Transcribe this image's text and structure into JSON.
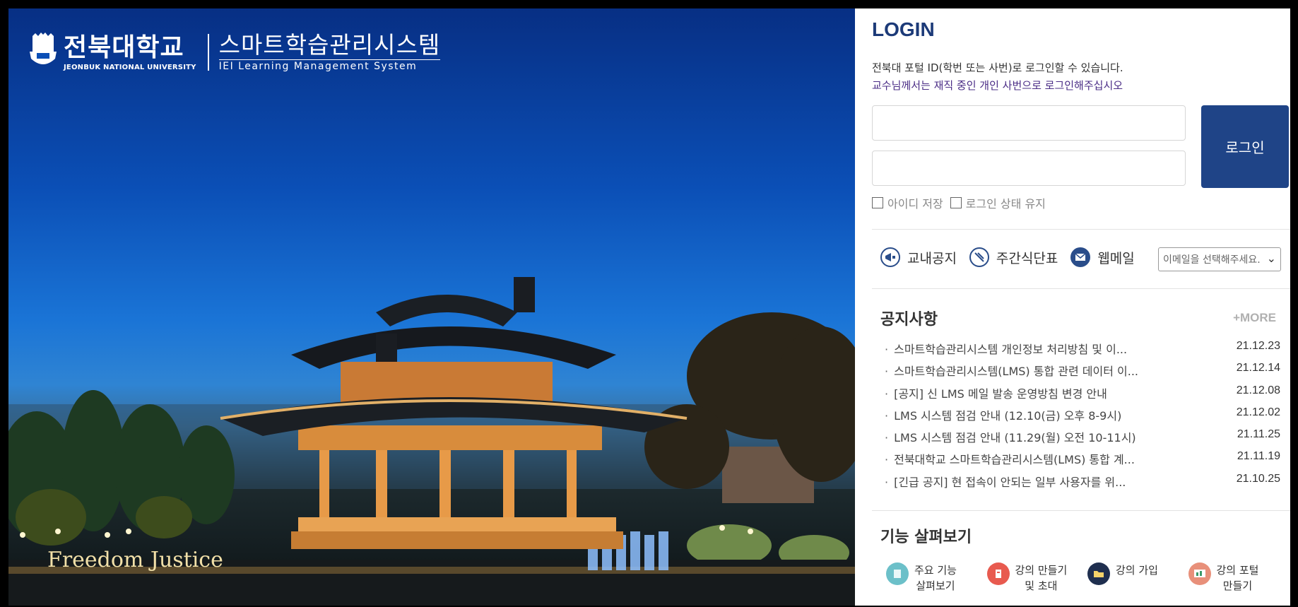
{
  "brand": {
    "university_ko": "전북대학교",
    "university_en": "JEONBUK NATIONAL UNIVERSITY",
    "system_ko": "스마트학습관리시스템",
    "system_en": "IEI Learning Management System",
    "sign_text": "Freedom Justice"
  },
  "login": {
    "title": "LOGIN",
    "notice_line1": "전북대 포털 ID(학번 또는 사번)로 로그인할 수 있습니다.",
    "notice_line2": "교수님께서는 재직 중인 개인 사번으로 로그인해주십시오",
    "id_value": "",
    "pw_value": "",
    "button_label": "로그인",
    "save_id_label": "아이디 저장",
    "keep_login_label": "로그인 상태 유지"
  },
  "quick_links": [
    {
      "label": "교내공지",
      "icon": "megaphone-icon"
    },
    {
      "label": "주간식단표",
      "icon": "utensils-icon"
    },
    {
      "label": "웹메일",
      "icon": "mail-icon"
    }
  ],
  "mail_select": {
    "selected": "이메일을 선택해주세요."
  },
  "notices": {
    "title": "공지사항",
    "more_label": "+MORE",
    "items": [
      {
        "title": "스마트학습관리시스템 개인정보 처리방침 및 이...",
        "date": "21.12.23"
      },
      {
        "title": "스마트학습관리시스템(LMS) 통합 관련 데이터 이...",
        "date": "21.12.14"
      },
      {
        "title": "[공지] 신 LMS 메일 발송 운영방침 변경 안내",
        "date": "21.12.08"
      },
      {
        "title": "LMS 시스템 점검 안내 (12.10(금) 오후 8-9시)",
        "date": "21.12.02"
      },
      {
        "title": "LMS 시스템 점검 안내 (11.29(월) 오전 10-11시)",
        "date": "21.11.25"
      },
      {
        "title": "전북대학교 스마트학습관리시스템(LMS) 통합 계...",
        "date": "21.11.19"
      },
      {
        "title": "[긴급 공지] 현 접속이 안되는 일부 사용자를 위...",
        "date": "21.10.25"
      }
    ]
  },
  "features": {
    "title": "기능 살펴보기",
    "items": [
      {
        "line1": "주요 기능",
        "line2": "살펴보기",
        "icon": "book-icon",
        "color": "#6cc0c9"
      },
      {
        "line1": "강의 만들기",
        "line2": "및 초대",
        "icon": "clipboard-icon",
        "color": "#e85a4f"
      },
      {
        "line1": "강의 가입",
        "line2": "",
        "icon": "folder-icon",
        "color": "#1f2f4f"
      },
      {
        "line1": "강의 포털",
        "line2": "만들기",
        "icon": "board-icon",
        "color": "#e8907a"
      }
    ]
  },
  "colors": {
    "primary": "#1f4487",
    "title": "#1c3a78",
    "notice_purple": "#4a2c86"
  }
}
